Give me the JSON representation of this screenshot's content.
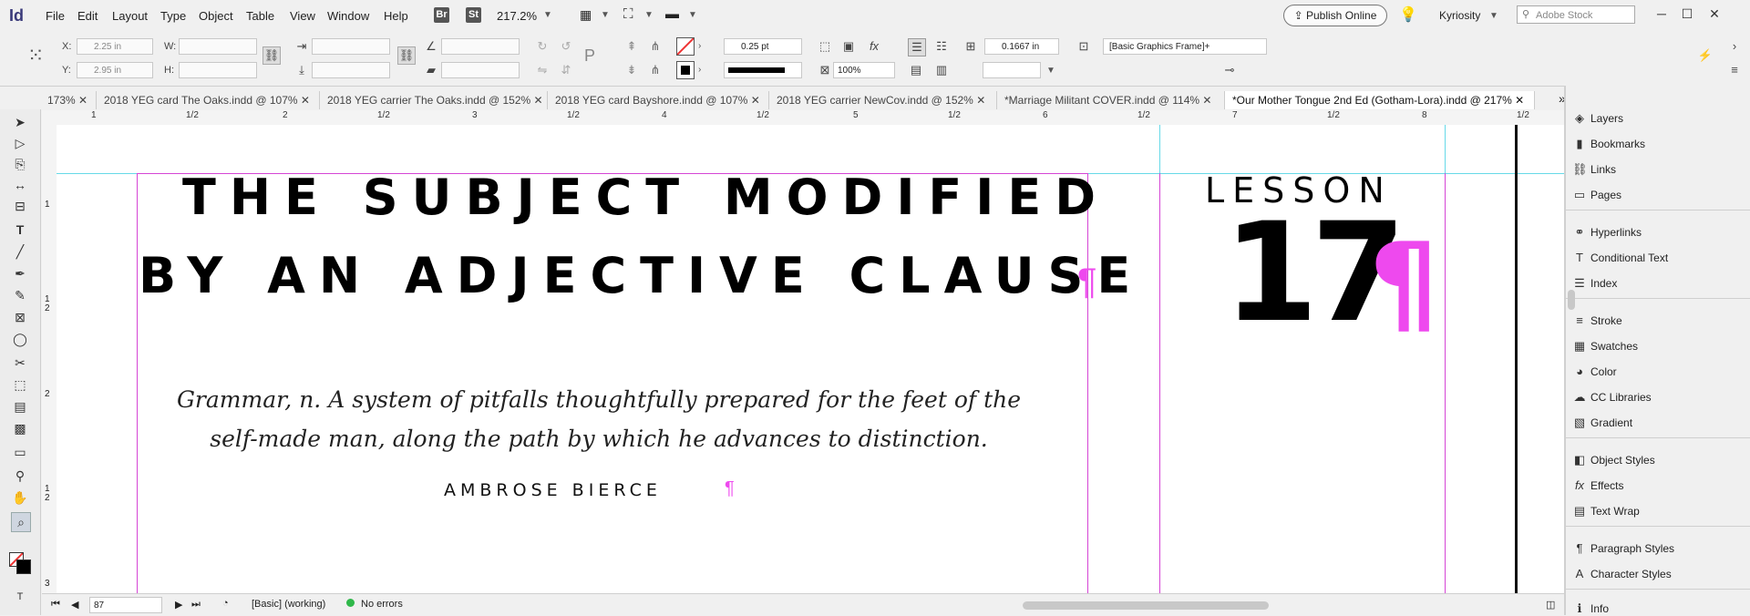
{
  "app": {
    "logo": "Id"
  },
  "menu": [
    "File",
    "Edit",
    "Layout",
    "Type",
    "Object",
    "Table",
    "View",
    "Window",
    "Help"
  ],
  "menubar": {
    "br": "Br",
    "st": "St",
    "zoom": "217.2%",
    "publish": "Publish Online",
    "user": "Kyriosity",
    "search_placeholder": "Adobe Stock"
  },
  "control": {
    "x_label": "X:",
    "x_value": "2.25 in",
    "y_label": "Y:",
    "y_value": "2.95 in",
    "w_label": "W:",
    "h_label": "H:",
    "stroke_weight": "0.25 pt",
    "scale": "100%",
    "fit_value": "0.1667 in",
    "object_style": "[Basic Graphics Frame]+",
    "fx": "fx"
  },
  "tabs": [
    "173%",
    "2018 YEG card The Oaks.indd @ 107%",
    "2018 YEG carrier The Oaks.indd @ 152%",
    "2018 YEG card Bayshore.indd @ 107%",
    "2018 YEG carrier NewCov.indd @ 152%",
    "*Marriage Militant COVER.indd @ 114%",
    "*Our Mother Tongue 2nd Ed (Gotham-Lora).indd @ 217%"
  ],
  "ruler": {
    "h": [
      "1",
      "1/2",
      "2",
      "1/2",
      "3",
      "1/2",
      "4",
      "1/2",
      "5",
      "1/2",
      "6",
      "1/2",
      "7",
      "1/2",
      "8",
      "1/2"
    ],
    "v": [
      "1",
      "1",
      "2",
      "2",
      "1",
      "2",
      "3"
    ]
  },
  "document": {
    "title_line1": "THE SUBJECT MODIFIED",
    "title_line2": "BY AN ADJECTIVE CLAUSE",
    "quote_line1": "Grammar, n. A system of pitfalls thoughtfully prepared for the feet of the",
    "quote_line2": "self-made man, along the path by which he advances to distinction.",
    "author": "AMBROSE BIERCE",
    "lesson_label": "LESSON",
    "lesson_number": "17",
    "pilcrow": "¶"
  },
  "status": {
    "page": "87",
    "style": "[Basic] (working)",
    "errors": "No errors"
  },
  "panel": {
    "groups": [
      [
        "Layers",
        "Bookmarks",
        "Links",
        "Pages"
      ],
      [
        "Hyperlinks",
        "Conditional Text",
        "Index"
      ],
      [
        "Stroke",
        "Swatches",
        "Color",
        "CC Libraries",
        "Gradient"
      ],
      [
        "Object Styles",
        "Effects",
        "Text Wrap"
      ],
      [
        "Paragraph Styles",
        "Character Styles"
      ],
      [
        "Info"
      ]
    ]
  },
  "colors": {
    "accent": "#ee49ee",
    "guide": "#66d9e8",
    "margin": "#d545d5"
  }
}
